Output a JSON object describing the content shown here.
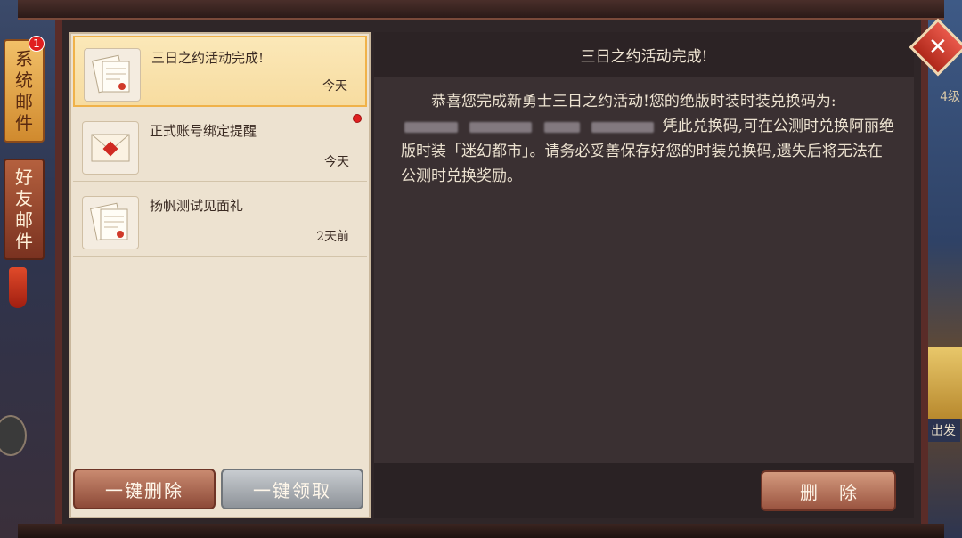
{
  "window": {
    "title": "三日之约活动完成!"
  },
  "tabs": [
    {
      "label_chars": [
        "系",
        "统",
        "邮",
        "件"
      ],
      "badge": "1",
      "active": true
    },
    {
      "label_chars": [
        "好",
        "友",
        "邮",
        "件"
      ],
      "active": false
    }
  ],
  "mail_list": [
    {
      "title": "三日之约活动完成!",
      "date": "今天",
      "selected": true,
      "unread": false,
      "icon": "letter-paper-icon"
    },
    {
      "title": "正式账号绑定提醒",
      "date": "今天",
      "selected": false,
      "unread": true,
      "icon": "sealed-envelope-icon"
    },
    {
      "title": "扬帆测试见面礼",
      "date": "2天前",
      "selected": false,
      "unread": false,
      "icon": "letter-paper-icon"
    }
  ],
  "list_buttons": {
    "delete_all": "一键删除",
    "claim_all": "一键领取"
  },
  "detail": {
    "title": "三日之约活动完成!",
    "body_part1": "恭喜您完成新勇士三日之约活动!您的绝版时装时装兑换码为:",
    "body_part2": "凭此兑换码,可在公测时兑换阿丽绝版时装「迷幻都市」。请务必妥善保存好您的时装兑换码,遗失后将无法在公测时兑换奖励。",
    "delete_label": "删除"
  },
  "background": {
    "level_text": "4级",
    "right_label": "出发"
  },
  "colors": {
    "selected_item": "#f7dca0",
    "accent_gold": "#f0b24a",
    "unread_red": "#e02020",
    "panel_dark": "#3a3032"
  }
}
